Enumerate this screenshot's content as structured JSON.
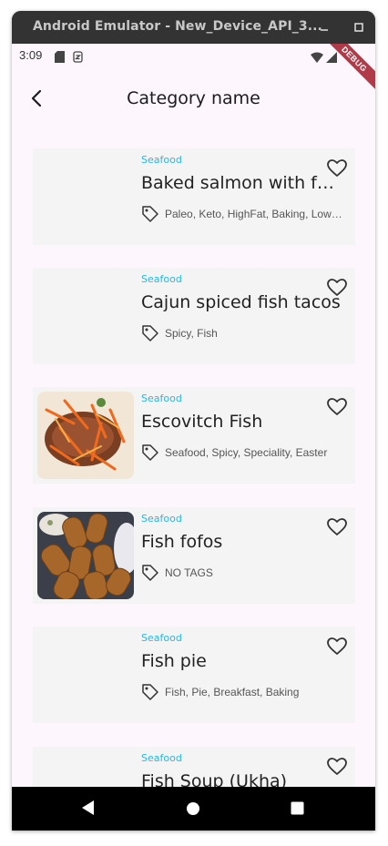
{
  "window": {
    "title": "Android Emulator - New_Device_API_3...",
    "minimize_icon": "minimize-icon",
    "maximize_icon": "maximize-icon"
  },
  "statusbar": {
    "time": "3:09",
    "debug_label": "DEBUG"
  },
  "appbar": {
    "title": "Category name",
    "back_icon": "arrow-back-icon"
  },
  "recipes": [
    {
      "category": "Seafood",
      "name": "Baked salmon with fe...",
      "tags": "Paleo, Keto, HighFat, Baking, LowC...",
      "has_image": false
    },
    {
      "category": "Seafood",
      "name": "Cajun spiced fish tacos",
      "tags": "Spicy, Fish",
      "has_image": false
    },
    {
      "category": "Seafood",
      "name": "Escovitch Fish",
      "tags": "Seafood, Spicy, Speciality, Easter",
      "has_image": true
    },
    {
      "category": "Seafood",
      "name": "Fish fofos",
      "tags": "NO TAGS",
      "has_image": true
    },
    {
      "category": "Seafood",
      "name": "Fish pie",
      "tags": "Fish, Pie, Breakfast, Baking",
      "has_image": false
    },
    {
      "category": "Seafood",
      "name": "Fish Soup (Ukha)",
      "tags": "",
      "has_image": false
    }
  ],
  "colors": {
    "category_text": "#29b6e8",
    "card_bg": "#f4f4f4",
    "screen_bg": "#fdf7fd",
    "debug_banner": "#b13a48"
  }
}
